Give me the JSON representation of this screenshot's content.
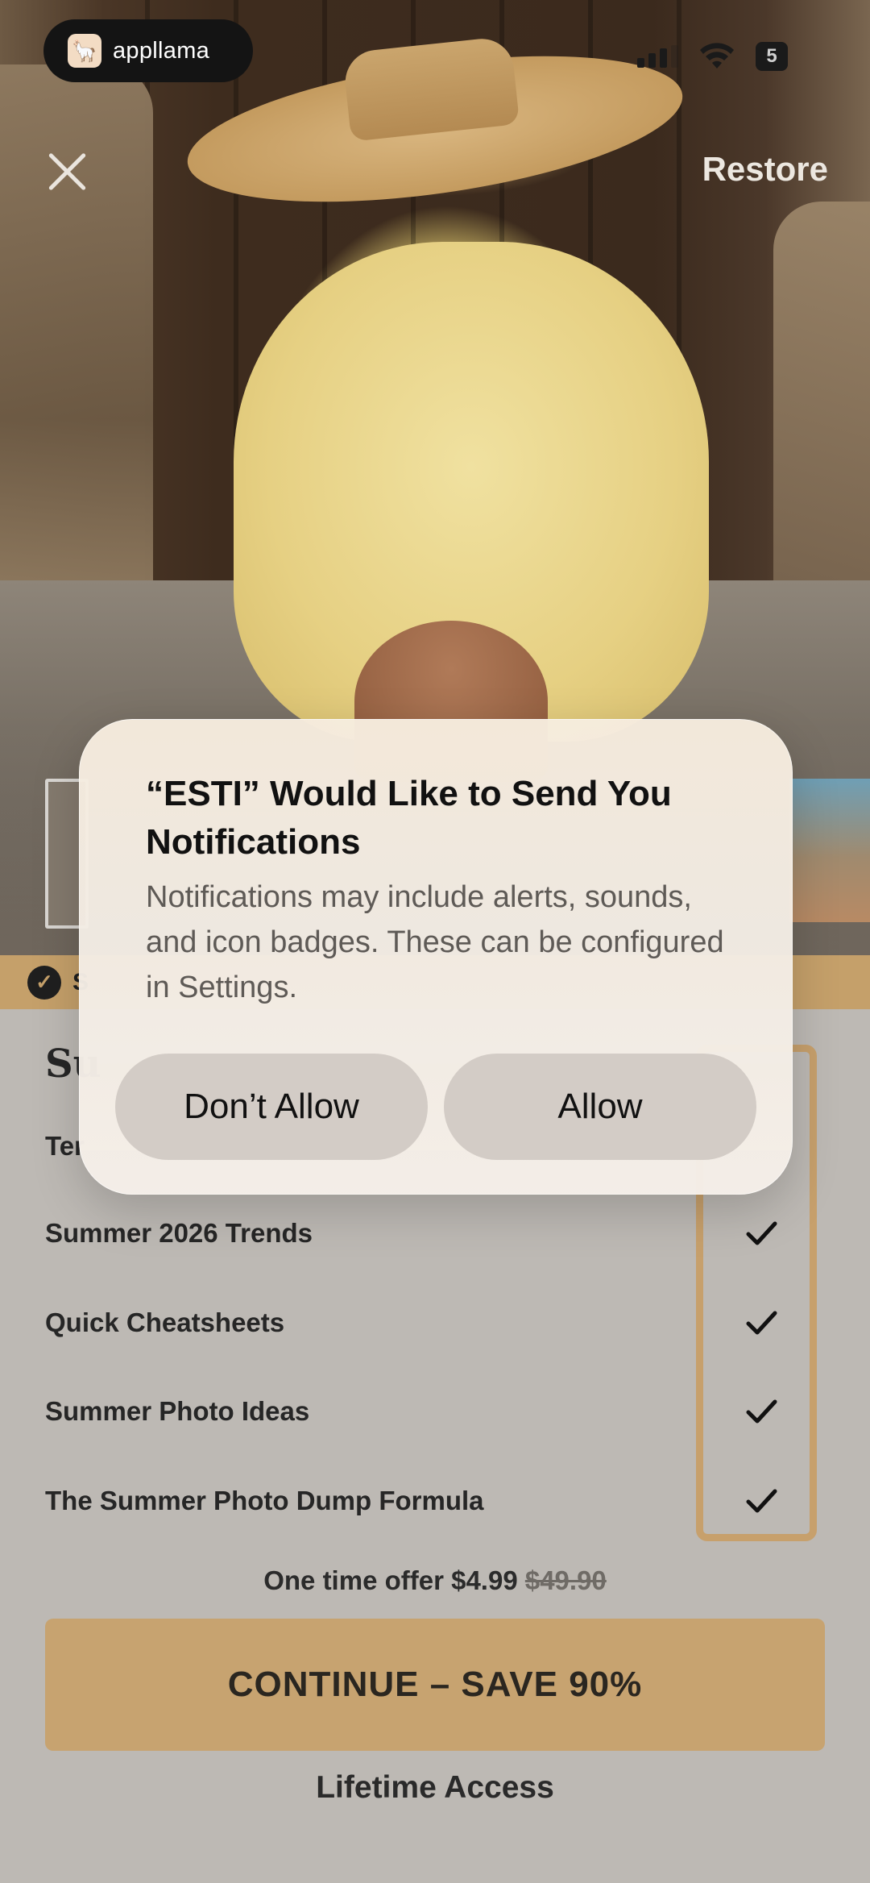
{
  "status_bar": {
    "app_name": "appllama",
    "battery": "5",
    "icons": [
      "signal-icon",
      "wifi-icon",
      "battery-icon"
    ]
  },
  "header": {
    "close_icon": "close-icon",
    "restore_label": "Restore"
  },
  "badge_bar": {
    "icon": "verified-badge-icon",
    "text": "S"
  },
  "features": {
    "title": "Su",
    "items": [
      {
        "label": "Ter"
      },
      {
        "label": "Summer 2026 Trends"
      },
      {
        "label": "Quick Cheatsheets"
      },
      {
        "label": "Summer Photo Ideas"
      },
      {
        "label": "The Summer Photo Dump Formula"
      }
    ]
  },
  "offer": {
    "prefix": "One time offer $4.99",
    "old_price": "$49.90"
  },
  "cta": {
    "label": "CONTINUE – SAVE 90%"
  },
  "lifetime_label": "Lifetime Access",
  "dialog": {
    "title": "“ESTI” Would Like to Send You Notifications",
    "message": "Notifications may include alerts, sounds, and icon badges. These can be configured in Settings.",
    "deny_label": "Don’t Allow",
    "allow_label": "Allow"
  },
  "colors": {
    "accent": "#c7a370",
    "badge_bar": "#c5a06a",
    "background": "#bdb9b4"
  }
}
